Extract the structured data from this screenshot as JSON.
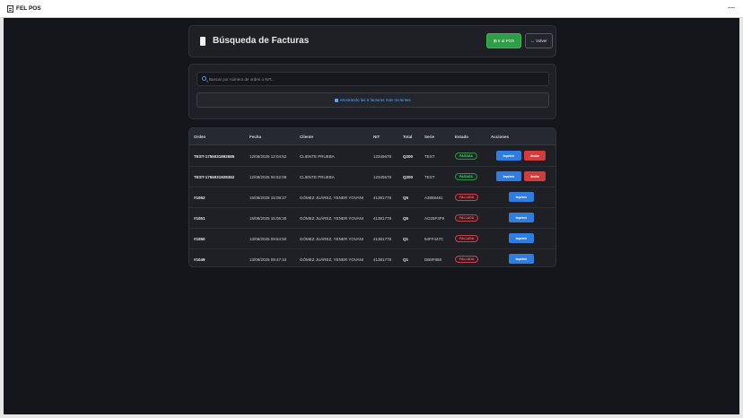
{
  "window": {
    "title": "FEL POS",
    "minimize": "—"
  },
  "header": {
    "title": "Búsqueda de Facturas",
    "pos_button": "⊞ Ir al POS",
    "back_button": "← Volver"
  },
  "search": {
    "placeholder": "Buscar por número de orden o NIT...",
    "info": "Mostrando las 6 facturas más recientes"
  },
  "table": {
    "headers": [
      "Orden",
      "Fecha",
      "Cliente",
      "NIT",
      "Total",
      "Serie",
      "Estado",
      "Acciones"
    ],
    "rows": [
      {
        "order": "TEST-1755031892685",
        "date": "12/08/2025 12:04:52",
        "client": "CLIENTE PRUEBA",
        "nit": "12345678",
        "total": "Q200",
        "serie": "TEST",
        "status": "PAGADA",
        "status_type": "ok",
        "actions": [
          "Imprimir",
          "Anular"
        ]
      },
      {
        "order": "TEST-1755031928362",
        "date": "12/08/2025 06:52:08",
        "client": "CLIENTE PRUEBA",
        "nit": "12345678",
        "total": "Q200",
        "serie": "TEST",
        "status": "PAGADA",
        "status_type": "ok",
        "actions": [
          "Imprimir",
          "Anular"
        ]
      },
      {
        "order": "#1052",
        "date": "15/08/2025 15:08:27",
        "client": "GÓMEZ JUÁREZ, YENER YOVANI",
        "nit": "41381778",
        "total": "Q5",
        "serie": "A3858481",
        "status": "FALLADA",
        "status_type": "bad",
        "actions": [
          "Imprimir"
        ]
      },
      {
        "order": "#1051",
        "date": "15/08/2025 15:05:30",
        "client": "GÓMEZ JUÁREZ, YENER YOVANI",
        "nit": "41381778",
        "total": "Q5",
        "serie": "AG25F3F9",
        "status": "FALLADA",
        "status_type": "bad",
        "actions": [
          "Imprimir"
        ]
      },
      {
        "order": "#1050",
        "date": "13/08/2025 09:54:50",
        "client": "GÓMEZ JUÁREZ, YENER YOVANI",
        "nit": "41381778",
        "total": "Q1",
        "serie": "54FF447C",
        "status": "FALLADA",
        "status_type": "bad",
        "actions": [
          "Imprimir"
        ]
      },
      {
        "order": "#1049",
        "date": "13/08/2025 09:47:10",
        "client": "GÓMEZ JUÁREZ, YENER YOVANI",
        "nit": "41381778",
        "total": "Q1",
        "serie": "DB8F858",
        "status": "FALLADA",
        "status_type": "bad",
        "actions": [
          "Imprimir"
        ]
      }
    ]
  },
  "colors": {
    "background": "#15161b",
    "card": "#1e2026",
    "accent_green": "#2e9e46",
    "accent_blue": "#2f7de1",
    "danger": "#d23c3c"
  },
  "icons": {
    "title": "document-icon",
    "search": "search-icon",
    "info": "info-icon"
  }
}
